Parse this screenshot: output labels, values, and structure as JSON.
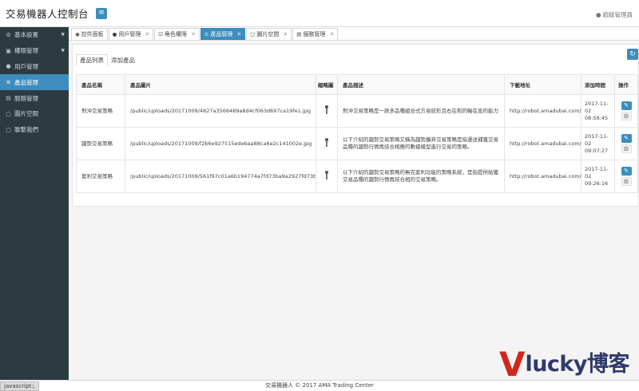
{
  "app": {
    "title": "交易機器人控制台",
    "user": "超級管理員"
  },
  "sidebar": {
    "items": [
      {
        "icon": "gear-icon",
        "glyph": "⚙",
        "label": "基本設置",
        "caret": true
      },
      {
        "icon": "lock-icon",
        "glyph": "▣",
        "label": "權限管理",
        "caret": true
      },
      {
        "icon": "user-icon",
        "glyph": "●",
        "label": "用戶管理",
        "caret": false
      },
      {
        "icon": "product-icon",
        "glyph": "≡",
        "label": "產品管理",
        "caret": false,
        "active": true
      },
      {
        "icon": "service-icon",
        "glyph": "▤",
        "label": "服務管理",
        "caret": false
      },
      {
        "icon": "image-space-icon",
        "glyph": "▢",
        "label": "圖片空間",
        "caret": false
      },
      {
        "icon": "contact-icon",
        "glyph": "▢",
        "label": "聯繫我們",
        "caret": false
      }
    ]
  },
  "tabs": [
    {
      "icon": "dashboard-icon",
      "glyph": "◉",
      "label": "控件面板",
      "closable": false
    },
    {
      "icon": "user-icon",
      "glyph": "●",
      "label": "用戶管理",
      "closable": true
    },
    {
      "icon": "check-icon",
      "glyph": "☑",
      "label": "角色權限",
      "closable": true
    },
    {
      "icon": "product-icon",
      "glyph": "≡",
      "label": "產品管理",
      "closable": true,
      "active": true
    },
    {
      "icon": "image-icon",
      "glyph": "▢",
      "label": "圖片空間",
      "closable": true
    },
    {
      "icon": "service-icon",
      "glyph": "▤",
      "label": "服務管理",
      "closable": true
    }
  ],
  "subtabs": {
    "list": "產品列表",
    "add": "添加產品"
  },
  "table": {
    "headers": [
      "產品名稱",
      "產品圖片",
      "縮略圖",
      "產品描述",
      "下載地址",
      "添加時間",
      "操作"
    ],
    "rows": [
      {
        "name": "對沖交易策略",
        "image": "/public/uploads/20171009/4827a3566489a8d4cf063d697ca19fe1.jpg",
        "desc": "對沖交易策略是一款多品種組合式方易結形且右在和的輸在息的能力",
        "url": "http://robot.amadubai.com/",
        "time": "2017-11-02 08:56:45"
      },
      {
        "name": "趨勢交易策略",
        "image": "/public/uploads/20171009/f2b6e927515edebaa88ca6e2c141002e.jpg",
        "desc": "以下介紹的趨勢交易策略又稱為趨勢擴弃交易策略是指運送補獲交易品種的趨勢行情再結合相應的數據模型進行交易的策略。",
        "url": "http://robot.amadubai.com/",
        "time": "2017-11-02 09:07:27"
      },
      {
        "name": "套利交易策略",
        "image": "/public/uploads/20171009/561f97c01a6b194774a7fd73ba9a2927fd73ba9a2",
        "desc": "以下介紹的趨勢交易策略的無完套利功能的策略系統，是指提供給獲交易品種的趨勢行情再結合相的交易策略。",
        "url": "http://robot.amadubai.com/",
        "time": "2017-11-02 09:26:16"
      }
    ]
  },
  "footer": "交易機器人 © 2017  AMA Trading Center",
  "status": "javascript:;",
  "watermark": {
    "v": "V",
    "text": "lucky博客"
  },
  "colors": {
    "accent": "#3c8dbc",
    "sidebar_bg": "#2c3b41",
    "watermark_red": "#d0271d",
    "watermark_navy": "#2f3a6b"
  }
}
